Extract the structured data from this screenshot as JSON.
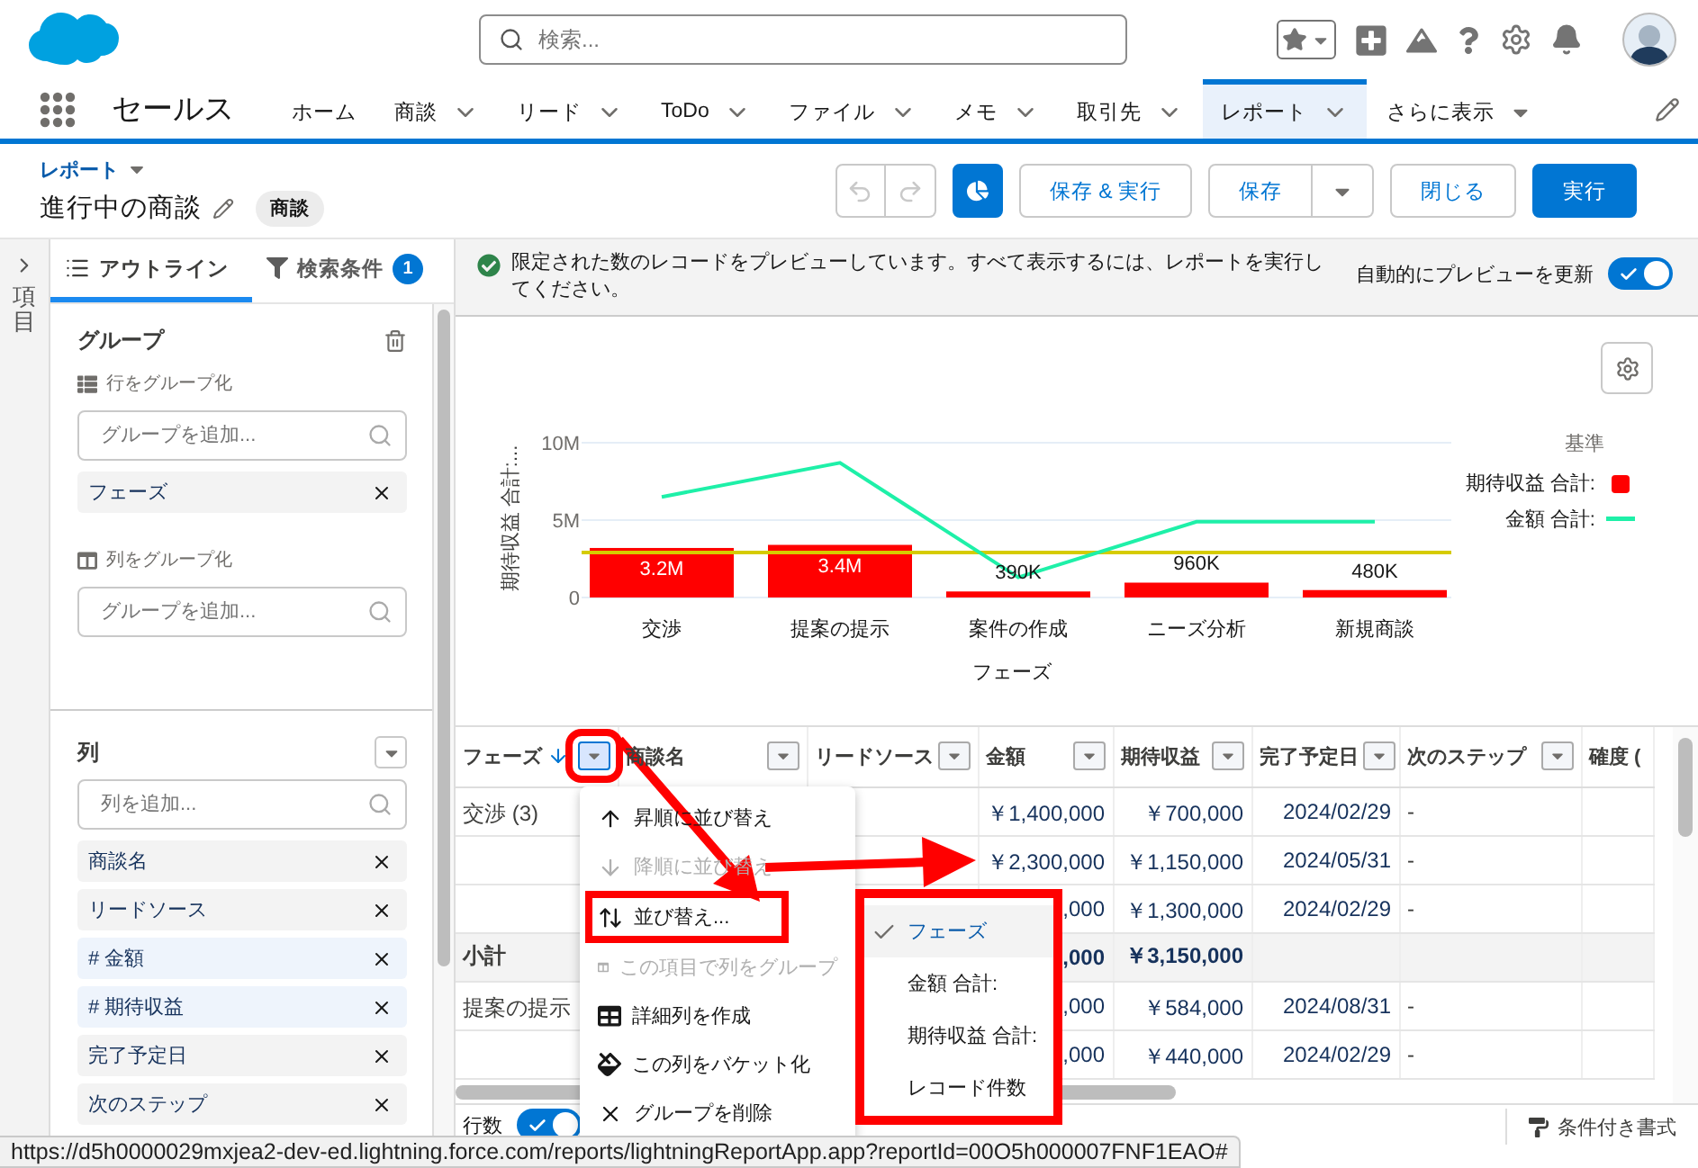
{
  "header": {
    "search_placeholder": "検索..."
  },
  "app_name": "セールス",
  "nav_tabs": [
    {
      "label": "ホーム",
      "kind": "tab",
      "has_menu": false,
      "selected": false
    },
    {
      "label": "商談",
      "kind": "tab",
      "has_menu": true,
      "selected": false
    },
    {
      "label": "リード",
      "kind": "tab",
      "has_menu": true,
      "selected": false
    },
    {
      "label": "ToDo",
      "kind": "tab",
      "has_menu": true,
      "selected": false
    },
    {
      "label": "ファイル",
      "kind": "tab",
      "has_menu": true,
      "selected": false
    },
    {
      "label": "メモ",
      "kind": "tab",
      "has_menu": true,
      "selected": false
    },
    {
      "label": "取引先",
      "kind": "tab",
      "has_menu": true,
      "selected": false
    },
    {
      "label": "レポート",
      "kind": "tab",
      "has_menu": true,
      "selected": true
    },
    {
      "label": "さらに表示",
      "kind": "more",
      "has_menu": true,
      "selected": false
    }
  ],
  "page_header": {
    "breadcrumb": "レポート",
    "title": "進行中の商談",
    "badge": "商談",
    "buttons": [
      {
        "label": "保存 & 実行",
        "kind": "neutral"
      },
      {
        "label": "保存",
        "kind": "split"
      },
      {
        "label": "閉じる",
        "kind": "neutral"
      },
      {
        "label": "実行",
        "kind": "brand"
      }
    ]
  },
  "side_strip": {
    "label": "項目"
  },
  "outline_panel": {
    "tabs": [
      {
        "label": "アウトライン",
        "selected": true
      },
      {
        "label": "検索条件",
        "selected": false,
        "badge": "1"
      }
    ],
    "groups": {
      "title": "グループ",
      "row_group": {
        "label": "行をグループ化",
        "placeholder": "グループを追加...",
        "items": [
          "フェーズ"
        ]
      },
      "column_group": {
        "label": "列をグループ化",
        "placeholder": "グループを追加..."
      }
    },
    "columns": {
      "title": "列",
      "placeholder": "列を追加...",
      "items": [
        {
          "label": "商談名",
          "kind": "text"
        },
        {
          "label": "リードソース",
          "kind": "text"
        },
        {
          "label": "# 金額",
          "kind": "number"
        },
        {
          "label": "# 期待収益",
          "kind": "number"
        },
        {
          "label": "完了予定日",
          "kind": "text"
        },
        {
          "label": "次のステップ",
          "kind": "text"
        }
      ]
    }
  },
  "banner": {
    "message": "限定された数のレコードをプレビューしています。すべて表示するには、レポートを実行してください。",
    "auto_preview_label": "自動的にプレビューを更新",
    "auto_preview_on": true
  },
  "chart": {
    "chart_data": {
      "type": "bar",
      "xlabel": "フェーズ",
      "ylabel": "期待収益 合計:...",
      "legend": {
        "title": "基準"
      },
      "ylim": [
        0,
        10000000
      ],
      "categories": [
        "交渉",
        "提案の提示",
        "案件の作成",
        "ニーズ分析",
        "新規商談"
      ],
      "series": [
        {
          "name": "期待収益 合計:",
          "color": "#ff0000",
          "type": "bar",
          "values": [
            3200000,
            3400000,
            390000,
            960000,
            480000
          ]
        },
        {
          "name": "金額 合計:",
          "color": "#1ef0a8",
          "type": "line",
          "values": [
            6500000,
            8700000,
            1300000,
            4900000,
            4900000
          ]
        }
      ],
      "value_labels": [
        "3.2M",
        "3.4M",
        "390K",
        "960K",
        "480K"
      ],
      "yticks": [
        {
          "value": 0,
          "label": "0"
        },
        {
          "value": 5000000,
          "label": "5M"
        },
        {
          "value": 10000000,
          "label": "10M"
        }
      ],
      "ref_lines": [
        {
          "axis": "y",
          "value": 2900000,
          "color": "#d6cb00"
        }
      ]
    }
  },
  "table": {
    "columns": [
      {
        "label": "フェーズ",
        "sorted": true,
        "menu_open": true
      },
      {
        "label": "商談名",
        "sorted": false,
        "menu_open": false
      },
      {
        "label": "リードソース",
        "sorted": false,
        "menu_open": false
      },
      {
        "label": "金額",
        "sorted": false,
        "menu_open": false
      },
      {
        "label": "期待収益",
        "sorted": false,
        "menu_open": false
      },
      {
        "label": "完了予定日",
        "sorted": false,
        "menu_open": false
      },
      {
        "label": "次のステップ",
        "sorted": false,
        "menu_open": false
      },
      {
        "label": "確度 (",
        "sorted": false,
        "menu_open": false
      }
    ],
    "rows": [
      {
        "kind": "detail",
        "cells": [
          "交渉 (3)",
          null,
          null,
          "￥1,400,000",
          "￥700,000",
          "2024/02/29",
          "-",
          null
        ]
      },
      {
        "kind": "detail",
        "cells": [
          null,
          null,
          null,
          "￥2,300,000",
          "￥1,150,000",
          "2024/05/31",
          "-",
          null
        ]
      },
      {
        "kind": "detail",
        "cells": [
          null,
          null,
          null,
          ",000",
          "￥1,300,000",
          "2024/02/29",
          "-",
          null
        ]
      },
      {
        "kind": "subtotal",
        "cells": [
          "小計",
          null,
          null,
          ",000",
          "￥3,150,000",
          null,
          null,
          null
        ]
      },
      {
        "kind": "detail",
        "cells": [
          "提案の提示",
          null,
          null,
          ",000",
          "￥584,000",
          "2024/08/31",
          "-",
          null
        ]
      },
      {
        "kind": "detail",
        "cells": [
          null,
          null,
          null,
          ",000",
          "￥440,000",
          "2024/02/29",
          "-",
          null
        ]
      }
    ]
  },
  "column_menu": {
    "highlighted": true,
    "items": [
      {
        "label": "昇順に並び替え",
        "disabled": false,
        "highlighted": false
      },
      {
        "label": "降順に並び替え",
        "disabled": true,
        "highlighted": false
      },
      {
        "label": "並び替え...",
        "disabled": false,
        "highlighted": true
      },
      {
        "label": "この項目で列をグループ",
        "disabled": true,
        "highlighted": false
      },
      {
        "label": "詳細列を作成",
        "disabled": false,
        "highlighted": false
      },
      {
        "label": "この列をバケット化",
        "disabled": false,
        "highlighted": false
      },
      {
        "label": "グループを削除",
        "disabled": false,
        "highlighted": false
      }
    ]
  },
  "sort_submenu": {
    "highlighted": true,
    "items": [
      {
        "label": "フェーズ",
        "selected": true
      },
      {
        "label": "金額 合計:",
        "selected": false
      },
      {
        "label": "期待収益 合計:",
        "selected": false
      },
      {
        "label": "レコード件数",
        "selected": false
      }
    ]
  },
  "footer": {
    "toggles": [
      {
        "label": "行数",
        "on": true
      }
    ],
    "button": "条件付き書式"
  },
  "status_url": "https://d5h0000029mxjea2-dev-ed.lightning.force.com/reports/lightningReportApp.app?reportId=00O5h000007FNF1EAO#"
}
